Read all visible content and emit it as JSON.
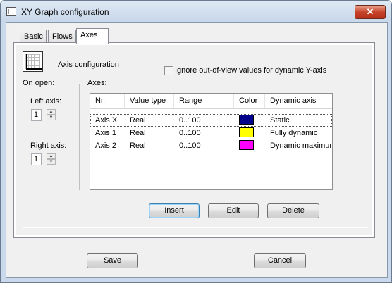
{
  "window": {
    "title": "XY Graph configuration",
    "close_label": "✕"
  },
  "tabs": [
    {
      "label": "Basic"
    },
    {
      "label": "Flows"
    },
    {
      "label": "Axes"
    }
  ],
  "axes_tab": {
    "heading": "Axis configuration",
    "ignore_checkbox": {
      "label": "Ignore out-of-view values for dynamic Y-axis",
      "checked": false
    },
    "on_open": {
      "group_label": "On open:",
      "left_axis": {
        "label": "Left axis:",
        "value": "1"
      },
      "right_axis": {
        "label": "Right axis:",
        "value": "1"
      }
    },
    "axes_group_label": "Axes:",
    "table": {
      "columns": [
        "Nr.",
        "Value type",
        "Range",
        "Color",
        "Dynamic axis"
      ],
      "rows": [
        {
          "nr": "Axis  X",
          "value_type": "Real",
          "range": "0..100",
          "color": "#00008b",
          "dynamic": "Static"
        },
        {
          "nr": "Axis  1",
          "value_type": "Real",
          "range": "0..100",
          "color": "#ffff00",
          "dynamic": "Fully dynamic"
        },
        {
          "nr": "Axis  2",
          "value_type": "Real",
          "range": "0..100",
          "color": "#ff00ff",
          "dynamic": "Dynamic maximun"
        }
      ]
    },
    "buttons": {
      "insert": "Insert",
      "edit": "Edit",
      "delete": "Delete"
    }
  },
  "footer": {
    "save": "Save",
    "cancel": "Cancel"
  }
}
